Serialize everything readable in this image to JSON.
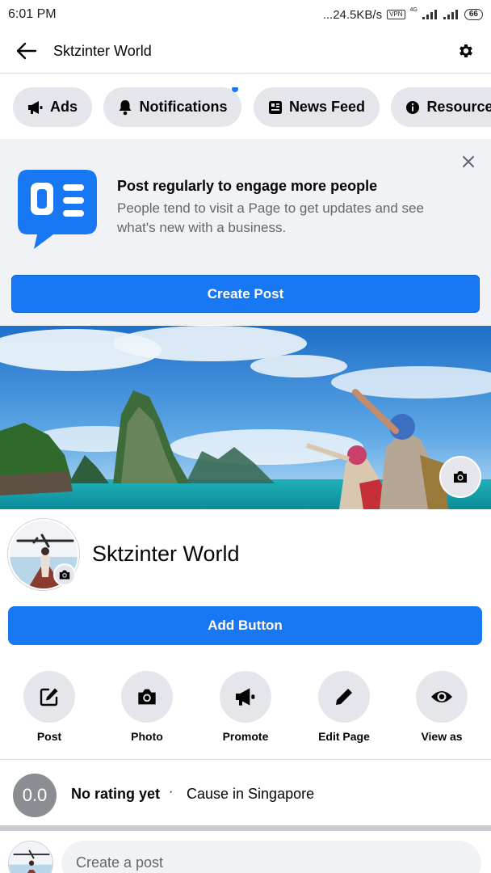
{
  "status_bar": {
    "time": "6:01 PM",
    "network_speed": "...24.5KB/s",
    "vpn": "VPN",
    "network_type": "4G",
    "battery": "66"
  },
  "app_bar": {
    "title": "Sktzinter World",
    "back_icon": "arrow-left-icon",
    "settings_icon": "gear-icon"
  },
  "chips": [
    {
      "label": "Ads",
      "icon": "megaphone-icon"
    },
    {
      "label": "Notifications",
      "icon": "bell-icon",
      "has_dot": true
    },
    {
      "label": "News Feed",
      "icon": "news-feed-icon"
    },
    {
      "label": "Resources",
      "icon": "info-icon"
    }
  ],
  "tip": {
    "title": "Post regularly to engage more people",
    "body": "People tend to visit a Page to get updates and see what's new with a business.",
    "button": "Create Post"
  },
  "profile": {
    "name": "Sktzinter World",
    "add_button": "Add Button"
  },
  "actions": [
    {
      "label": "Post",
      "icon": "edit-icon"
    },
    {
      "label": "Photo",
      "icon": "camera-icon"
    },
    {
      "label": "Promote",
      "icon": "megaphone-icon"
    },
    {
      "label": "Edit Page",
      "icon": "pencil-icon"
    },
    {
      "label": "View as",
      "icon": "eye-icon"
    }
  ],
  "rating": {
    "score": "0.0",
    "text": "No rating yet",
    "separator": "·",
    "category": "Cause in Singapore"
  },
  "composer": {
    "placeholder": "Create a post"
  },
  "colors": {
    "accent": "#1877f2",
    "chip_bg": "#e4e6eb",
    "card_bg": "#f0f2f5",
    "rating_badge": "#8a8d91"
  }
}
